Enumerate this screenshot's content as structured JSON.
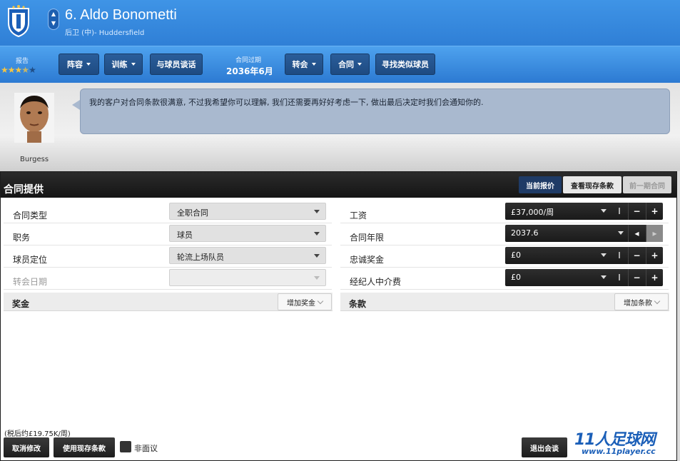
{
  "header": {
    "player_name": "6. Aldo Bonometti",
    "player_subtitle": "后卫 (中)- Huddersfield"
  },
  "toolbar": {
    "report_label": "报告",
    "rating_stars": 3.5,
    "rating_max": 5,
    "squad_label": "阵容",
    "training_label": "训练",
    "talk_label": "与球员谈话",
    "contract_expiry_label": "合同过期",
    "contract_expiry_value": "2036年6月",
    "transfer_label": "转会",
    "contract_label": "合同",
    "find_similar_label": "寻找类似球员"
  },
  "agent": {
    "name": "Burgess",
    "message": "我的客户对合同条款很满意, 不过我希望你可以理解, 我们还需要再好好考虑一下, 做出最后决定时我们会通知你的."
  },
  "contract_panel": {
    "title": "合同提供",
    "tabs": [
      {
        "label": "当前报价",
        "state": "active"
      },
      {
        "label": "查看现存条款",
        "state": "normal"
      },
      {
        "label": "前一期合同",
        "state": "disabled"
      }
    ],
    "left_rows": [
      {
        "label": "合同类型",
        "value": "全职合同"
      },
      {
        "label": "职务",
        "value": "球员"
      },
      {
        "label": "球员定位",
        "value": "轮流上场队员"
      },
      {
        "label": "转会日期",
        "value": ""
      }
    ],
    "right_rows": [
      {
        "label": "工资",
        "value": "£37,000/周"
      },
      {
        "label": "合同年限",
        "value": "2037.6"
      },
      {
        "label": "忠诚奖金",
        "value": "£0"
      },
      {
        "label": "经纪人中介费",
        "value": "£0"
      }
    ],
    "bonus_section": {
      "label": "奖金",
      "button": "增加奖金"
    },
    "clauses_section": {
      "label": "条款",
      "button": "增加条款"
    },
    "net_wage_note": "(税后约£19.75K/周)",
    "cancel_changes": "取消修改",
    "use_existing_terms": "使用现存条款",
    "non_negotiable_label": "非面议",
    "exit_talks": "退出会谈"
  },
  "watermark": {
    "main": "11人足球网",
    "url": "www.11player.cc"
  },
  "colors": {
    "header_blue": "#3f94e6",
    "toolbar_button": "#2a5d9a",
    "active_tab": "#1f3b66",
    "bubble": "#a9b9cf"
  }
}
